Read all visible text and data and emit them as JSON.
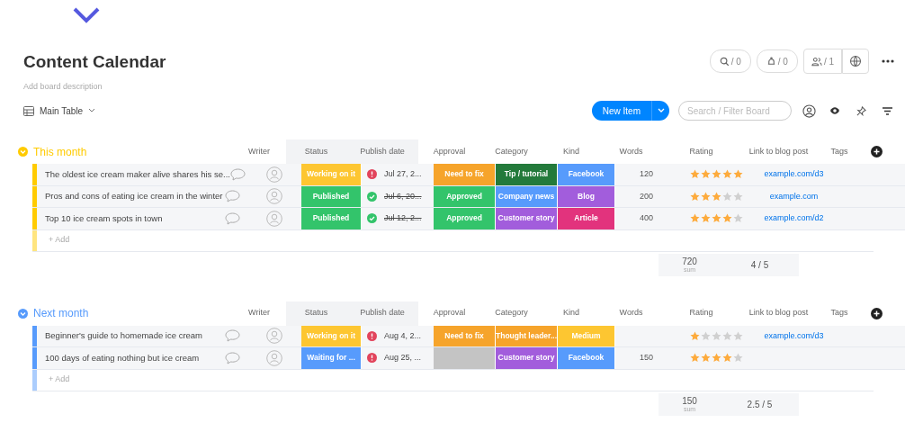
{
  "board": {
    "title": "Content Calendar",
    "description": "Add board description",
    "view": "Main Table"
  },
  "top_buttons": [
    {
      "kind": "search",
      "label": "/ 0"
    },
    {
      "kind": "activity",
      "label": "/ 0"
    },
    {
      "kind": "people",
      "label": "/ 1"
    }
  ],
  "toolbar": {
    "new_item": "New Item",
    "search": {
      "placeholder": "Search / Filter Board"
    }
  },
  "groups": [
    {
      "name": "This month",
      "color": "#ffcb00",
      "columns": [
        "Writer",
        "Status",
        "Publish date",
        "Approval",
        "Category",
        "Kind",
        "Words",
        "Rating",
        "Link to blog post",
        "Tags"
      ],
      "rows": [
        {
          "name": "The oldest ice cream maker alive shares his se...",
          "status": {
            "text": "Working on it",
            "color": "#fdc631"
          },
          "date": {
            "text": "Jul 27, 2...",
            "done": false
          },
          "approval": {
            "text": "Need to fix",
            "color": "#f6a42b"
          },
          "category": {
            "text": "Tip / tutorial",
            "color": "#237a3b"
          },
          "kind_label": {
            "text": "Facebook",
            "color": "#579bfc"
          },
          "words": "120",
          "stars": 5,
          "link": "example.com/d3"
        },
        {
          "name": "Pros and cons of eating ice cream in the winter",
          "status": {
            "text": "Published",
            "color": "#33c46b"
          },
          "date": {
            "text": "Jul 6, 20...",
            "done": true
          },
          "approval": {
            "text": "Approved",
            "color": "#33c46b"
          },
          "category": {
            "text": "Company news",
            "color": "#579bfc"
          },
          "kind_label": {
            "text": "Blog",
            "color": "#a25ddc"
          },
          "words": "200",
          "stars": 3,
          "link": "example.com"
        },
        {
          "name": "Top 10 ice cream spots in town",
          "status": {
            "text": "Published",
            "color": "#33c46b"
          },
          "date": {
            "text": "Jul 12, 2...",
            "done": true
          },
          "approval": {
            "text": "Approved",
            "color": "#33c46b"
          },
          "category": {
            "text": "Customer story",
            "color": "#a25ddc"
          },
          "kind_label": {
            "text": "Article",
            "color": "#e2337d"
          },
          "words": "400",
          "stars": 4,
          "link": "example.com/d2"
        }
      ],
      "add_label": "+ Add",
      "summary": {
        "words": "720",
        "words_caption": "sum",
        "rating": "4 / 5"
      }
    },
    {
      "name": "Next month",
      "color": "#579bfc",
      "columns": [
        "Writer",
        "Status",
        "Publish date",
        "Approval",
        "Category",
        "Kind",
        "Words",
        "Rating",
        "Link to blog post",
        "Tags"
      ],
      "rows": [
        {
          "name": "Beginner's guide to homemade ice cream",
          "status": {
            "text": "Working on it",
            "color": "#fdc631"
          },
          "date": {
            "text": "Aug 4, 2...",
            "done": false
          },
          "approval": {
            "text": "Need to fix",
            "color": "#f6a42b"
          },
          "category": {
            "text": "Thought leader...",
            "color": "#f6a42b"
          },
          "kind_label": {
            "text": "Medium",
            "color": "#fdc631"
          },
          "stars": 1,
          "link": "example.com/d3"
        },
        {
          "name": "100 days of eating nothing but ice cream",
          "status": {
            "text": "Waiting for ...",
            "color": "#579bfc"
          },
          "date": {
            "text": "Aug 25, ...",
            "done": false
          },
          "approval": {
            "color": "#c4c4c4"
          },
          "category": {
            "text": "Customer story",
            "color": "#a25ddc"
          },
          "kind_label": {
            "text": "Facebook",
            "color": "#579bfc"
          },
          "words": "150",
          "stars": 4
        }
      ],
      "add_label": "+ Add",
      "summary": {
        "words": "150",
        "words_caption": "sum",
        "rating": "2.5 / 5"
      }
    }
  ]
}
